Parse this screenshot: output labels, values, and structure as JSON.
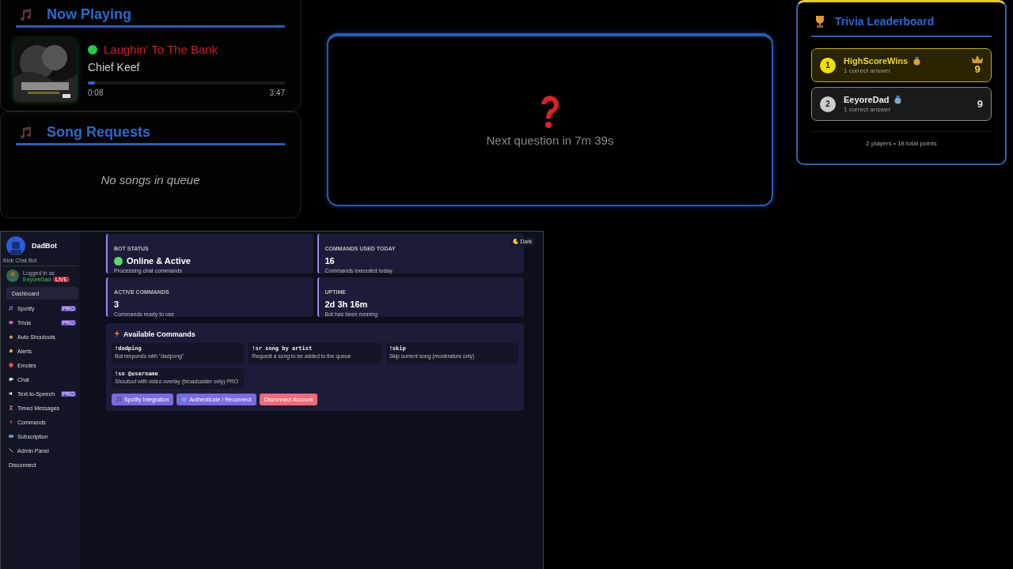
{
  "now_playing": {
    "title": "Now Playing",
    "playing": true,
    "track": "Laughin' To The Bank",
    "artist": "Chief Keef",
    "progress": {
      "level": 0.035
    },
    "elapsed": "0:08",
    "duration": "3:47"
  },
  "song_requests": {
    "title": "Song Requests",
    "empty_message": "No songs in queue"
  },
  "trivia_question": {
    "message": "Next question in 7m 39s"
  },
  "leaderboard": {
    "title": "Trivia Leaderboard",
    "players": [
      {
        "rank": "1",
        "name": "HighScoreWins",
        "detail": "1 correct answer",
        "points": "9",
        "leader": true
      },
      {
        "rank": "2",
        "name": "EeyoreDad",
        "detail": "1 correct answer",
        "points": "9",
        "leader": false
      }
    ],
    "footer": "2 players • 18 total points"
  },
  "dashboard": {
    "brand": "DadBot",
    "subtitle": "Kick Chat Bot",
    "user": {
      "label": "Logged in as",
      "name": "EeyoreDad",
      "badge": "LIVE"
    },
    "nav": [
      {
        "label": "Dashboard",
        "selected": true
      },
      {
        "label": "Spotify",
        "selected": false,
        "badge": "PRO"
      },
      {
        "label": "Trivia",
        "selected": false,
        "badge": "PRO"
      },
      {
        "label": "Auto Shoutouts",
        "selected": false
      },
      {
        "label": "Alerts",
        "selected": false
      },
      {
        "label": "Emotes",
        "selected": false
      },
      {
        "label": "Chat",
        "selected": false
      },
      {
        "label": "Text-to-Speech",
        "selected": false,
        "badge": "PRO"
      },
      {
        "label": "Timed Messages",
        "selected": false
      },
      {
        "label": "Commands",
        "selected": false
      },
      {
        "label": "Subscription",
        "selected": false
      },
      {
        "label": "Admin Panel",
        "selected": false
      }
    ],
    "disconnect": "Disconnect",
    "theme_toggle": "Dark",
    "stats": [
      {
        "label": "BOT STATUS",
        "value": "Online & Active",
        "online": true,
        "detail": "Processing chat commands"
      },
      {
        "label": "COMMANDS USED TODAY",
        "value": "16",
        "detail": "Commands executed today"
      },
      {
        "label": "ACTIVE COMMANDS",
        "value": "3",
        "detail": "Commands ready to use"
      },
      {
        "label": "UPTIME",
        "value": "2d 3h 16m",
        "detail": "Bot has been running"
      }
    ],
    "commands_title": "Available Commands",
    "commands": [
      {
        "name": "!dadping",
        "description": "Bot responds with \"dadpong\""
      },
      {
        "name": "!sr song by artist",
        "description": "Request a song to be added to the queue"
      },
      {
        "name": "!skip",
        "description": "Skip current song (moderators only)"
      },
      {
        "name": "!so @username",
        "description": "Shoutout with video overlay (broadcaster only) PRO"
      }
    ],
    "buttons": [
      {
        "label": "Spotify Integration",
        "kind": "spotify"
      },
      {
        "label": "Authenticate / Reconnect",
        "kind": "auth"
      },
      {
        "label": "Disconnect Account",
        "kind": "danger"
      }
    ]
  }
}
